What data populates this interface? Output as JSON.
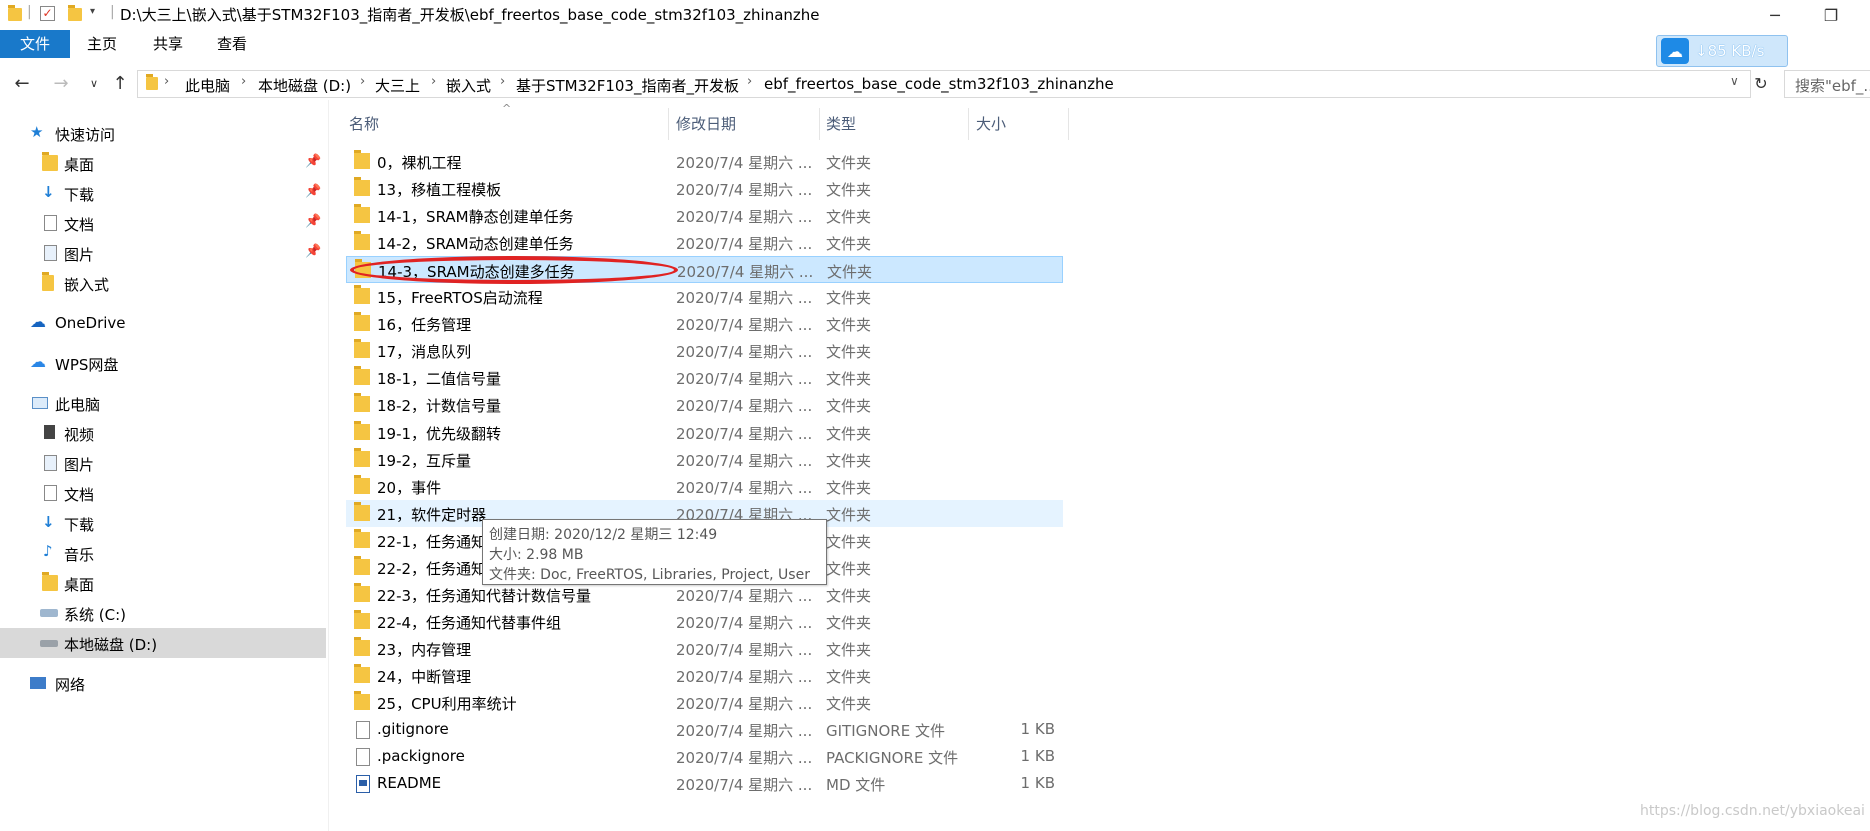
{
  "window": {
    "title": "D:\\大三上\\嵌入式\\基于STM32F103_指南者_开发板\\ebf_freertos_base_code_stm32f103_zhinanzhe"
  },
  "ribbon": {
    "tabs": [
      "文件",
      "主页",
      "共享",
      "查看"
    ]
  },
  "network_widget": {
    "speed": "↓85 KB/s"
  },
  "address": {
    "crumbs": [
      "此电脑",
      "本地磁盘 (D:)",
      "大三上",
      "嵌入式",
      "基于STM32F103_指南者_开发板",
      "ebf_freertos_base_code_stm32f103_zhinanzhe"
    ],
    "search_placeholder": "搜索\"ebf_..."
  },
  "sidebar": {
    "quick_access": "快速访问",
    "quick_items": [
      "桌面",
      "下载",
      "文档",
      "图片",
      "嵌入式"
    ],
    "onedrive": "OneDrive",
    "wps": "WPS网盘",
    "this_pc": "此电脑",
    "pc_items": [
      "视频",
      "图片",
      "文档",
      "下载",
      "音乐",
      "桌面",
      "系统 (C:)",
      "本地磁盘 (D:)"
    ],
    "network": "网络"
  },
  "columns": {
    "name": "名称",
    "date": "修改日期",
    "type": "类型",
    "size": "大小"
  },
  "files": [
    {
      "name": "0，裸机工程",
      "date": "2020/7/4 星期六 ...",
      "type": "文件夹",
      "size": "",
      "kind": "folder"
    },
    {
      "name": "13，移植工程模板",
      "date": "2020/7/4 星期六 ...",
      "type": "文件夹",
      "size": "",
      "kind": "folder"
    },
    {
      "name": "14-1，SRAM静态创建单任务",
      "date": "2020/7/4 星期六 ...",
      "type": "文件夹",
      "size": "",
      "kind": "folder"
    },
    {
      "name": "14-2，SRAM动态创建单任务",
      "date": "2020/7/4 星期六 ...",
      "type": "文件夹",
      "size": "",
      "kind": "folder"
    },
    {
      "name": "14-3，SRAM动态创建多任务",
      "date": "2020/7/4 星期六 ...",
      "type": "文件夹",
      "size": "",
      "kind": "folder"
    },
    {
      "name": "15，FreeRTOS启动流程",
      "date": "2020/7/4 星期六 ...",
      "type": "文件夹",
      "size": "",
      "kind": "folder"
    },
    {
      "name": "16，任务管理",
      "date": "2020/7/4 星期六 ...",
      "type": "文件夹",
      "size": "",
      "kind": "folder"
    },
    {
      "name": "17，消息队列",
      "date": "2020/7/4 星期六 ...",
      "type": "文件夹",
      "size": "",
      "kind": "folder"
    },
    {
      "name": "18-1，二值信号量",
      "date": "2020/7/4 星期六 ...",
      "type": "文件夹",
      "size": "",
      "kind": "folder"
    },
    {
      "name": "18-2，计数信号量",
      "date": "2020/7/4 星期六 ...",
      "type": "文件夹",
      "size": "",
      "kind": "folder"
    },
    {
      "name": "19-1，优先级翻转",
      "date": "2020/7/4 星期六 ...",
      "type": "文件夹",
      "size": "",
      "kind": "folder"
    },
    {
      "name": "19-2，互斥量",
      "date": "2020/7/4 星期六 ...",
      "type": "文件夹",
      "size": "",
      "kind": "folder"
    },
    {
      "name": "20，事件",
      "date": "2020/7/4 星期六 ...",
      "type": "文件夹",
      "size": "",
      "kind": "folder"
    },
    {
      "name": "21，软件定时器",
      "date": "2020/7/4 星期六 ...",
      "type": "文件夹",
      "size": "",
      "kind": "folder"
    },
    {
      "name": "22-1，任务通知",
      "date": "",
      "type": "文件夹",
      "size": "",
      "kind": "folder"
    },
    {
      "name": "22-2，任务通知",
      "date": "",
      "type": "文件夹",
      "size": "",
      "kind": "folder"
    },
    {
      "name": "22-3，任务通知代替计数信号量",
      "date": "2020/7/4 星期六 ...",
      "type": "文件夹",
      "size": "",
      "kind": "folder"
    },
    {
      "name": "22-4，任务通知代替事件组",
      "date": "2020/7/4 星期六 ...",
      "type": "文件夹",
      "size": "",
      "kind": "folder"
    },
    {
      "name": "23，内存管理",
      "date": "2020/7/4 星期六 ...",
      "type": "文件夹",
      "size": "",
      "kind": "folder"
    },
    {
      "name": "24，中断管理",
      "date": "2020/7/4 星期六 ...",
      "type": "文件夹",
      "size": "",
      "kind": "folder"
    },
    {
      "name": "25，CPU利用率统计",
      "date": "2020/7/4 星期六 ...",
      "type": "文件夹",
      "size": "",
      "kind": "folder"
    },
    {
      "name": ".gitignore",
      "date": "2020/7/4 星期六 ...",
      "type": "GITIGNORE 文件",
      "size": "1 KB",
      "kind": "file"
    },
    {
      "name": ".packignore",
      "date": "2020/7/4 星期六 ...",
      "type": "PACKIGNORE 文件",
      "size": "1 KB",
      "kind": "file"
    },
    {
      "name": "README",
      "date": "2020/7/4 星期六 ...",
      "type": "MD 文件",
      "size": "1 KB",
      "kind": "md"
    }
  ],
  "selected_index": 4,
  "hover_index": 13,
  "tooltip": {
    "created": "创建日期: 2020/12/2 星期三 12:49",
    "size": "大小: 2.98 MB",
    "contents": "文件夹: Doc, FreeRTOS, Libraries, Project, User"
  },
  "watermark": "https://blog.csdn.net/ybxiaokeai"
}
